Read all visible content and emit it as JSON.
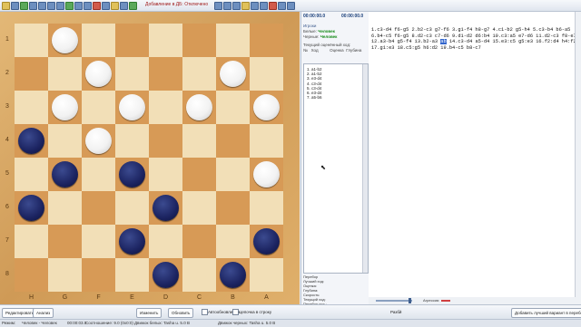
{
  "window": {
    "status_message": "Добавление в ДБ: Отключено"
  },
  "board": {
    "ranks": [
      "1",
      "2",
      "3",
      "4",
      "5",
      "6",
      "7",
      "8"
    ],
    "files": [
      "H",
      "G",
      "F",
      "E",
      "D",
      "C",
      "B",
      "A"
    ],
    "pieces": [
      {
        "row": 0,
        "col": 1,
        "color": "white"
      },
      {
        "row": 1,
        "col": 2,
        "color": "white"
      },
      {
        "row": 1,
        "col": 6,
        "color": "white"
      },
      {
        "row": 2,
        "col": 1,
        "color": "white"
      },
      {
        "row": 2,
        "col": 3,
        "color": "white"
      },
      {
        "row": 2,
        "col": 5,
        "color": "white"
      },
      {
        "row": 2,
        "col": 7,
        "color": "white"
      },
      {
        "row": 3,
        "col": 0,
        "color": "black"
      },
      {
        "row": 3,
        "col": 2,
        "color": "white"
      },
      {
        "row": 4,
        "col": 1,
        "color": "black"
      },
      {
        "row": 4,
        "col": 3,
        "color": "black"
      },
      {
        "row": 4,
        "col": 7,
        "color": "white"
      },
      {
        "row": 5,
        "col": 0,
        "color": "black"
      },
      {
        "row": 5,
        "col": 4,
        "color": "black"
      },
      {
        "row": 6,
        "col": 3,
        "color": "black"
      },
      {
        "row": 6,
        "col": 7,
        "color": "black"
      },
      {
        "row": 7,
        "col": 4,
        "color": "black"
      },
      {
        "row": 7,
        "col": 6,
        "color": "black"
      }
    ],
    "colors": {
      "light": "#f2dfb7",
      "dark": "#d79a56",
      "white_piece": "#ffffff",
      "black_piece": "#1b2360"
    }
  },
  "clocks": {
    "white_time": "00:00:00.0",
    "black_time": "00:00:00.0"
  },
  "players": {
    "section_label": "Игроки",
    "white_label": "Белые:",
    "white_name": "Человек",
    "black_label": "Черные:",
    "black_name": "Человек"
  },
  "movelist": {
    "title": "Текущий оценённый ход:",
    "col_num": "№",
    "col_move": "Ход",
    "col_eval": "Оценка",
    "col_depth": "Глубина",
    "rows": [
      "1. a1-b2",
      "2. a1-b2",
      "3. e3-d4",
      "4. c3-d4",
      "5. c3-d4",
      "6. e3-d4",
      "7. a5-b6"
    ]
  },
  "analysis": {
    "title": "Перебор",
    "best_move": "Лучший ход:",
    "eval": "Оценка:",
    "depth": "Глубина:",
    "speed": "Скорость:",
    "current_move": "Текущий ход:",
    "search_pos": "Перебор поз.:",
    "queries": "Запросы в ЭБ:",
    "table_queries": "Хэш таблица:"
  },
  "notation": {
    "text": "1.c3-d4 f6-g5 2.b2-c3 g7-f6 3.g1-f4 h8-g7 4.c1-b2 g5-h4 5.c3-b4 b6-a5 6.b4-c5 f6-g5 8.d2-c3 c7-d6 9.d1-d2 d6:b4 10.c3:a5 e7-d6 11.d2-c3 f8-e7 12.a3-b4 g5-f4 13.b2-a3 [ab] 14.c3-d4 a5-d4 15.e3:c5 g5:e3 16.f2:d4 h4:f2 17.g1:e3 18.c5:g5 h6:d2 19.b4-c5 b8-c7",
    "highlight": "ab"
  },
  "engine": {
    "aggression_label": "Агрессия:",
    "aggression_level": 0.3
  },
  "actions": {
    "edit": "Редактировать",
    "analyze": "Анализ",
    "change": "Изменить",
    "update": "Обновить",
    "auto_update": "Автообновление",
    "in_string": "Цепочка в строку",
    "engine_label": "Разбй",
    "apply_best": "Добавить лучший вариант в перебор"
  },
  "status": {
    "mode_label": "Режим:",
    "mode_value": "Человек - Человек",
    "time": "00:00:03.0",
    "ratio": "Соотношение: 9.0 (0x0:0)",
    "white_engine": "Движок белых: Tasha u. 5.0 B",
    "black_engine": "Движок черных: Tasha u. 5.0 B"
  }
}
